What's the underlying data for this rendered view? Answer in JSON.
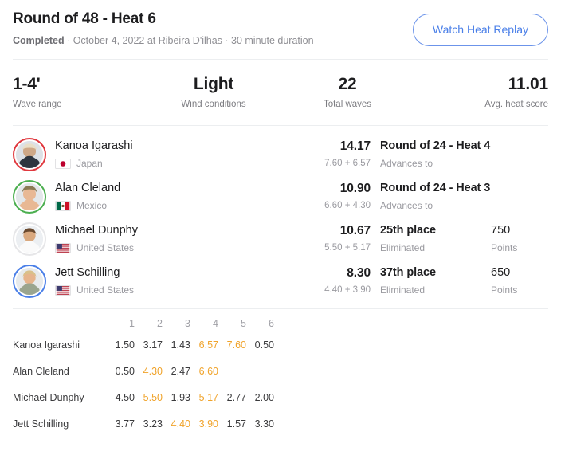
{
  "header": {
    "title": "Round of 48 - Heat 6",
    "status": "Completed",
    "meta_rest": " · October 4, 2022 at Ribeira D'ilhas · 30 minute duration",
    "replay_button": "Watch Heat Replay",
    "accent_blue": "#4a7fe8"
  },
  "stats": [
    {
      "value": "1-4'",
      "label": "Wave range"
    },
    {
      "value": "Light",
      "label": "Wind conditions"
    },
    {
      "value": "22",
      "label": "Total waves"
    },
    {
      "value": "11.01",
      "label": "Avg. heat score"
    }
  ],
  "athletes": [
    {
      "name": "Kanoa Igarashi",
      "country": "Japan",
      "flag": "jp-flag-icon",
      "jersey_color": "#e0383e",
      "total": "14.17",
      "breakdown": "7.60 + 6.57",
      "result": "Round of 24 - Heat 4",
      "result_sub": "Advances to",
      "points": "",
      "points_label": ""
    },
    {
      "name": "Alan Cleland",
      "country": "Mexico",
      "flag": "mx-flag-icon",
      "jersey_color": "#4caf50",
      "total": "10.90",
      "breakdown": "6.60 + 4.30",
      "result": "Round of 24 - Heat 3",
      "result_sub": "Advances to",
      "points": "",
      "points_label": ""
    },
    {
      "name": "Michael Dunphy",
      "country": "United States",
      "flag": "us-flag-icon",
      "jersey_color": "#e6e6e8",
      "total": "10.67",
      "breakdown": "5.50 + 5.17",
      "result": "25th place",
      "result_sub": "Eliminated",
      "points": "750",
      "points_label": "Points"
    },
    {
      "name": "Jett Schilling",
      "country": "United States",
      "flag": "us-flag-icon",
      "jersey_color": "#4a7fe8",
      "total": "8.30",
      "breakdown": "4.40 + 3.90",
      "result": "37th place",
      "result_sub": "Eliminated",
      "points": "650",
      "points_label": "Points"
    }
  ],
  "wave_table": {
    "columns": [
      "1",
      "2",
      "3",
      "4",
      "5",
      "6"
    ],
    "highlight_color": "#f0a32a",
    "rows": [
      {
        "name": "Kanoa Igarashi",
        "scores": [
          "1.50",
          "3.17",
          "1.43",
          "6.57",
          "7.60",
          "0.50"
        ],
        "counted": [
          false,
          false,
          false,
          true,
          true,
          false
        ]
      },
      {
        "name": "Alan Cleland",
        "scores": [
          "0.50",
          "4.30",
          "2.47",
          "6.60",
          "",
          ""
        ],
        "counted": [
          false,
          true,
          false,
          true,
          false,
          false
        ]
      },
      {
        "name": "Michael Dunphy",
        "scores": [
          "4.50",
          "5.50",
          "1.93",
          "5.17",
          "2.77",
          "2.00"
        ],
        "counted": [
          false,
          true,
          false,
          true,
          false,
          false
        ]
      },
      {
        "name": "Jett Schilling",
        "scores": [
          "3.77",
          "3.23",
          "4.40",
          "3.90",
          "1.57",
          "3.30"
        ],
        "counted": [
          false,
          false,
          true,
          true,
          false,
          false
        ]
      }
    ]
  }
}
